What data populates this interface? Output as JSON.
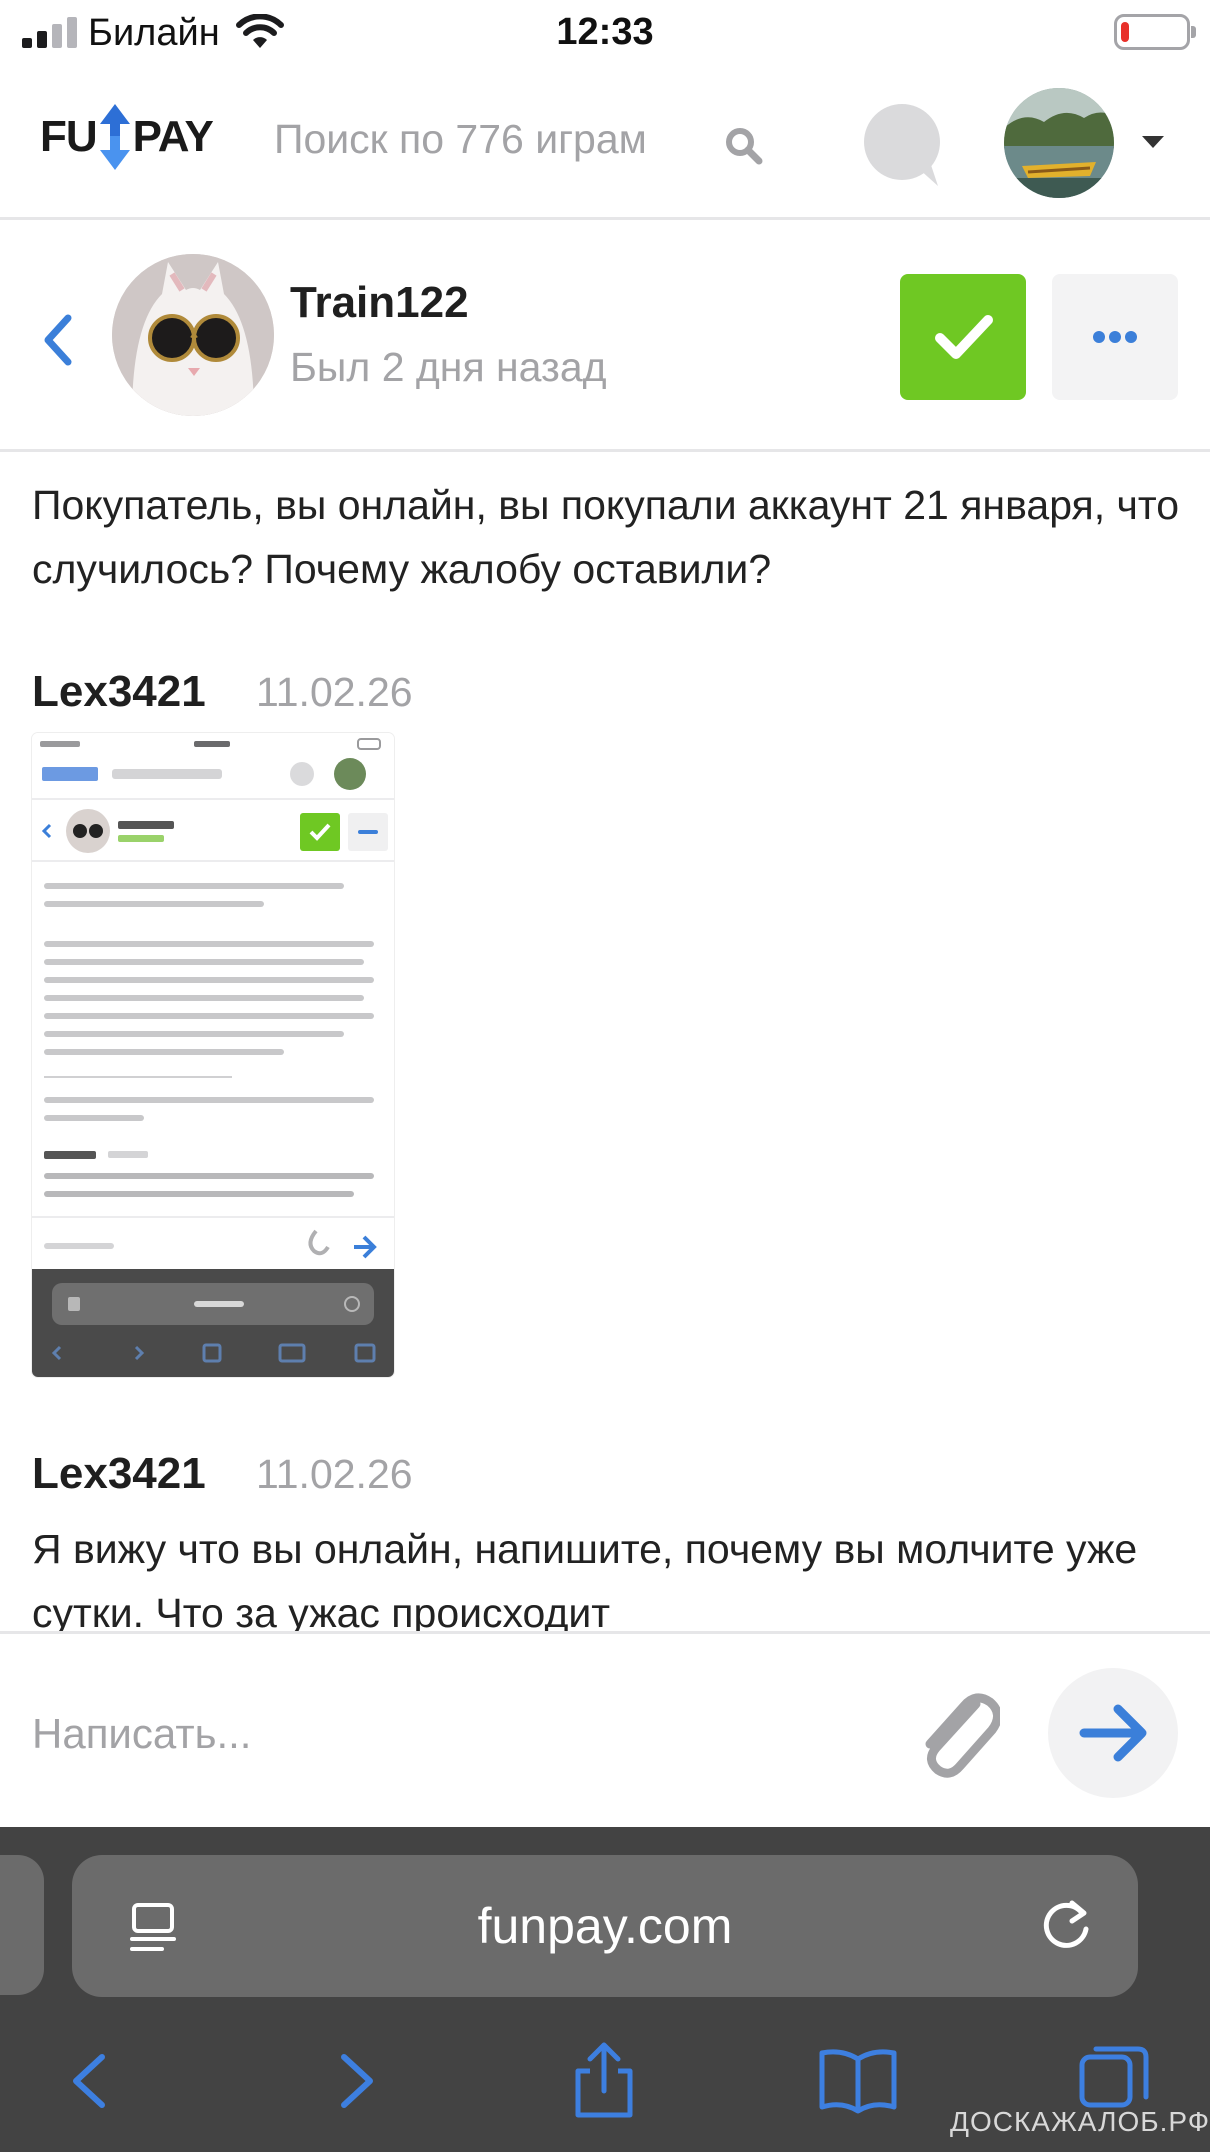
{
  "status_bar": {
    "carrier": "Билайн",
    "time": "12:33",
    "battery_level": 0.12,
    "signal_bars": 2
  },
  "header": {
    "logo_left": "FU",
    "logo_right": "PAY",
    "search_placeholder": "Поиск по 776 играм"
  },
  "chat": {
    "user_name": "Train122",
    "user_status": "Был 2 дня назад"
  },
  "messages": [
    {
      "text": "Покупатель, вы онлайн, вы покупали аккаунт 21 января, что случилось? Почему жалобу оставили?"
    },
    {
      "author": "Lex3421",
      "date": "11.02.26",
      "attachment": "screenshot"
    },
    {
      "author": "Lex3421",
      "date": "11.02.26",
      "text": "Я вижу что вы онлайн, напишите, почему вы молчите уже сутки. Что за ужас происходит"
    }
  ],
  "input": {
    "placeholder": "Написать..."
  },
  "safari": {
    "url": "funpay.com"
  },
  "watermark": "ДОСКАЖАЛОБ.РФ",
  "colors": {
    "accent_blue": "#3b7fd9",
    "confirm_green": "#6fc823",
    "muted_gray": "#a3a3a6",
    "safari_bar": "#434343"
  }
}
